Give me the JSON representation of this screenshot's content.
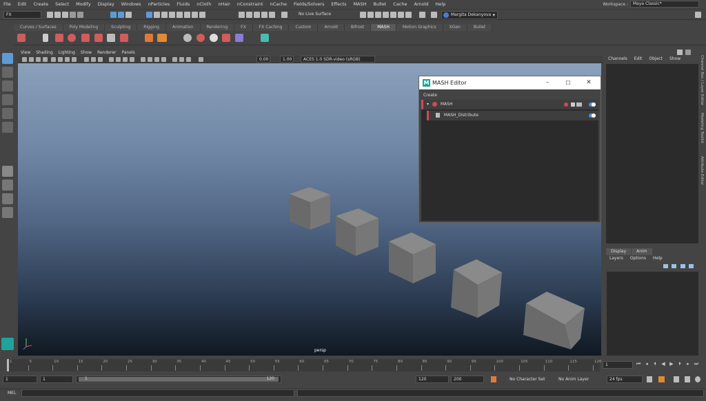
{
  "menubar": {
    "items": [
      "File",
      "Edit",
      "Create",
      "Select",
      "Modify",
      "Display",
      "Windows",
      "nParticles",
      "Fluids",
      "nCloth",
      "nHair",
      "nConstraint",
      "nCache",
      "Fields/Solvers",
      "Effects",
      "MASH",
      "Bullet",
      "Cache",
      "Arnold",
      "Help"
    ],
    "workspace_label": "Workspace :",
    "workspace_value": "Maya Classic*"
  },
  "statusline": {
    "menu_set": "FX",
    "live_surface": "No Live Surface",
    "user": "Margita Dekanyova"
  },
  "shelf": {
    "tabs": [
      "Curves / Surfaces",
      "Poly Modeling",
      "Sculpting",
      "Rigging",
      "Animation",
      "Rendering",
      "FX",
      "FX Caching",
      "Custom",
      "Arnold",
      "Bifrost",
      "MASH",
      "Motion Graphics",
      "XGen",
      "Bullet"
    ],
    "active_tab": "MASH"
  },
  "viewport": {
    "menu": [
      "View",
      "Shading",
      "Lighting",
      "Show",
      "Renderer",
      "Panels"
    ],
    "exposure": "0.00",
    "gamma": "1.00",
    "color_space": "ACES 1.0 SDR-video (sRGB)",
    "camera_label": "persp"
  },
  "mash_editor": {
    "title": "MASH Editor",
    "menu_create": "Create",
    "rows": [
      {
        "label": "MASH"
      },
      {
        "label": "MASH_Distribute"
      }
    ],
    "accent": "#d04a52"
  },
  "channel_box": {
    "menu": [
      "Channels",
      "Edit",
      "Object",
      "Show"
    ],
    "side_tabs": [
      "Channel Box / Layer Editor",
      "Modeling Toolkit",
      "Attribute Editor"
    ],
    "layer_tabs": [
      "Display",
      "Anim"
    ],
    "layer_menu": [
      "Layers",
      "Options",
      "Help"
    ]
  },
  "timeline": {
    "ticks": [
      "1",
      "5",
      "10",
      "15",
      "20",
      "25",
      "30",
      "35",
      "40",
      "45",
      "50",
      "55",
      "60",
      "65",
      "70",
      "75",
      "80",
      "85",
      "90",
      "95",
      "100",
      "105",
      "110",
      "115",
      "120"
    ],
    "current_frame": "1"
  },
  "range": {
    "start": "1",
    "playback_start": "1",
    "slider_start": "1",
    "slider_end": "120",
    "playback_end": "120",
    "end": "200",
    "character_set": "No Character Set",
    "anim_layer": "No Anim Layer",
    "fps": "24 fps"
  },
  "command_line": {
    "label": "MEL"
  }
}
